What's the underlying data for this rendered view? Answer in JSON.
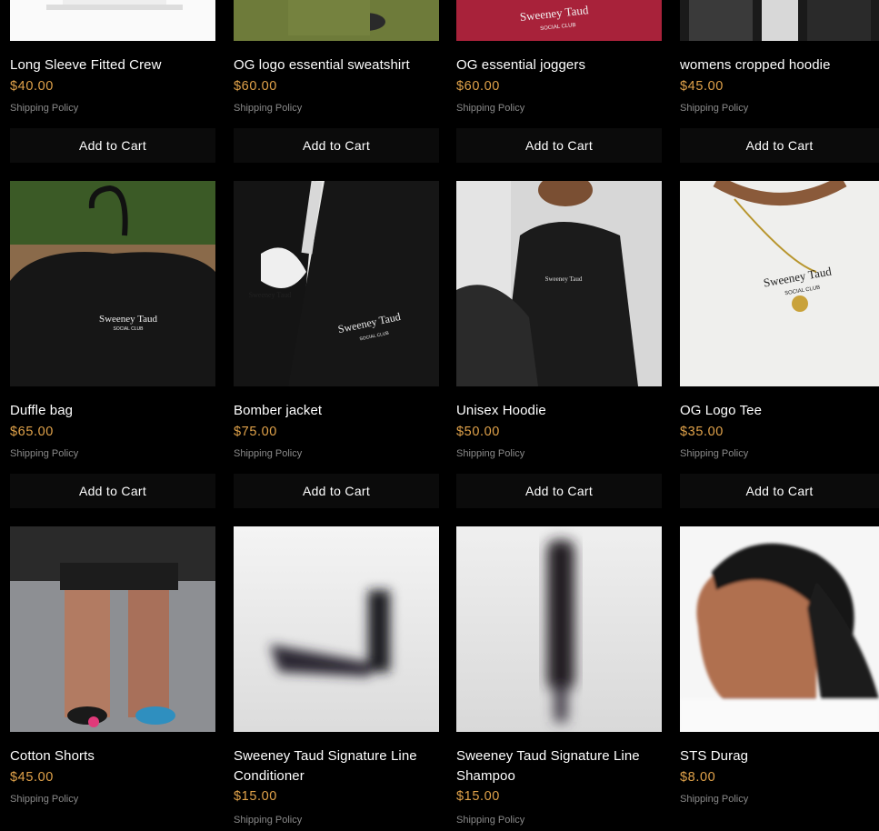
{
  "products": [
    {
      "name": "Long Sleeve Fitted Crew",
      "price": "$40.00",
      "shipping": "Shipping Policy",
      "button": "Add to Cart",
      "image_icon": "white-shirt-image"
    },
    {
      "name": "OG logo essential sweatshirt",
      "price": "$60.00",
      "shipping": "Shipping Policy",
      "button": "Add to Cart",
      "image_icon": "olive-sweatshirt-image"
    },
    {
      "name": "OG essential joggers",
      "price": "$60.00",
      "shipping": "Shipping Policy",
      "button": "Add to Cart",
      "image_icon": "red-joggers-image",
      "logo_text": "Sweeney Taud",
      "logo_sub": "SOCIAL CLUB"
    },
    {
      "name": "womens cropped hoodie",
      "price": "$45.00",
      "shipping": "Shipping Policy",
      "button": "Add to Cart",
      "image_icon": "cropped-hoodie-image"
    },
    {
      "name": "Duffle bag",
      "price": "$65.00",
      "shipping": "Shipping Policy",
      "button": "Add to Cart",
      "image_icon": "duffle-bag-image",
      "logo_text": "Sweeney Taud",
      "logo_sub": "SOCIAL CLUB"
    },
    {
      "name": "Bomber jacket",
      "price": "$75.00",
      "shipping": "Shipping Policy",
      "button": "Add to Cart",
      "image_icon": "bomber-jacket-image",
      "logo_text": "Sweeney Taud",
      "logo_sub": "SOCIAL CLUB"
    },
    {
      "name": "Unisex Hoodie",
      "price": "$50.00",
      "shipping": "Shipping Policy",
      "button": "Add to Cart",
      "image_icon": "unisex-hoodie-image",
      "logo_text": "Sweeney Taud",
      "logo_sub": "SOCIAL CLUB"
    },
    {
      "name": "OG Logo Tee",
      "price": "$35.00",
      "shipping": "Shipping Policy",
      "button": "Add to Cart",
      "image_icon": "white-tee-image",
      "logo_text": "Sweeney Taud",
      "logo_sub": "SOCIAL CLUB"
    },
    {
      "name": "Cotton Shorts",
      "price": "$45.00",
      "shipping": "Shipping Policy",
      "image_icon": "cotton-shorts-image"
    },
    {
      "name": "Sweeney Taud Signature Line Conditioner",
      "price": "$15.00",
      "shipping": "Shipping Policy",
      "image_icon": "conditioner-bottle-image"
    },
    {
      "name": "Sweeney Taud Signature Line Shampoo",
      "price": "$15.00",
      "shipping": "Shipping Policy",
      "image_icon": "shampoo-bottle-image"
    },
    {
      "name": "STS Durag",
      "price": "$8.00",
      "shipping": "Shipping Policy",
      "image_icon": "durag-image"
    }
  ],
  "colors": {
    "background": "#000000",
    "price": "#e0a24a",
    "muted": "#8a8a8a",
    "button_bg": "#0b0b0b"
  }
}
